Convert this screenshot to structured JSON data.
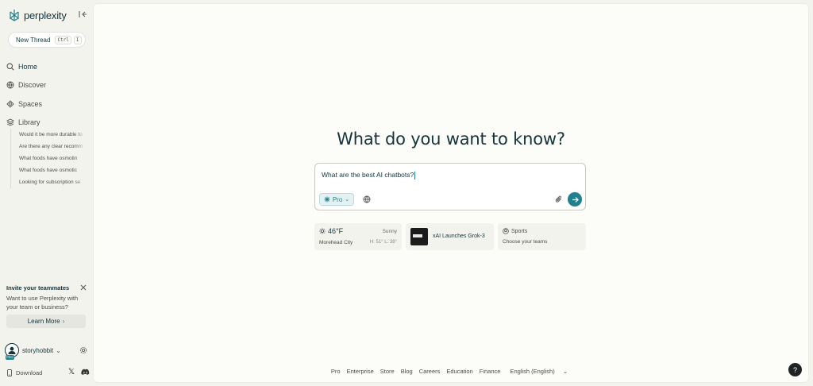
{
  "brand": {
    "name": "perplexity"
  },
  "sidebar": {
    "new_thread": {
      "label": "New Thread",
      "keys": [
        "Ctrl",
        "I"
      ]
    },
    "nav": [
      {
        "label": "Home",
        "icon": "search-icon"
      },
      {
        "label": "Discover",
        "icon": "globe-icon"
      },
      {
        "label": "Spaces",
        "icon": "spaces-icon"
      },
      {
        "label": "Library",
        "icon": "library-icon"
      }
    ],
    "library_items": [
      "Would it be more durable to",
      "Are there any clear recomm",
      "What foods have osmotin",
      "What foods have osmotic",
      "Looking for subscription se"
    ],
    "invite": {
      "title": "Invite your teammates",
      "body": "Want to use Perplexity with your team or business?",
      "button": "Learn More"
    },
    "user": {
      "name": "storyhobbit",
      "badge": "PRO"
    },
    "download": "Download"
  },
  "main": {
    "headline": "What do you want to know?",
    "search": {
      "value": "What are the best AI chatbots?",
      "mode": "Pro"
    },
    "cards": {
      "weather": {
        "temp": "46°F",
        "condition": "Sunny",
        "city": "Morehead City",
        "hilo": "H: 51° L: 38°"
      },
      "news": {
        "title": "xAI Launches Grok-3"
      },
      "sports": {
        "label": "Sports",
        "sub": "Choose your teams"
      }
    },
    "footer": [
      "Pro",
      "Enterprise",
      "Store",
      "Blog",
      "Careers",
      "Education",
      "Finance",
      "English (English)"
    ],
    "help": "?"
  },
  "colors": {
    "accent": "#20808d",
    "sidebar_bg": "#f3f3ee",
    "main_bg": "#fcfcf9",
    "text": "#13343b"
  }
}
